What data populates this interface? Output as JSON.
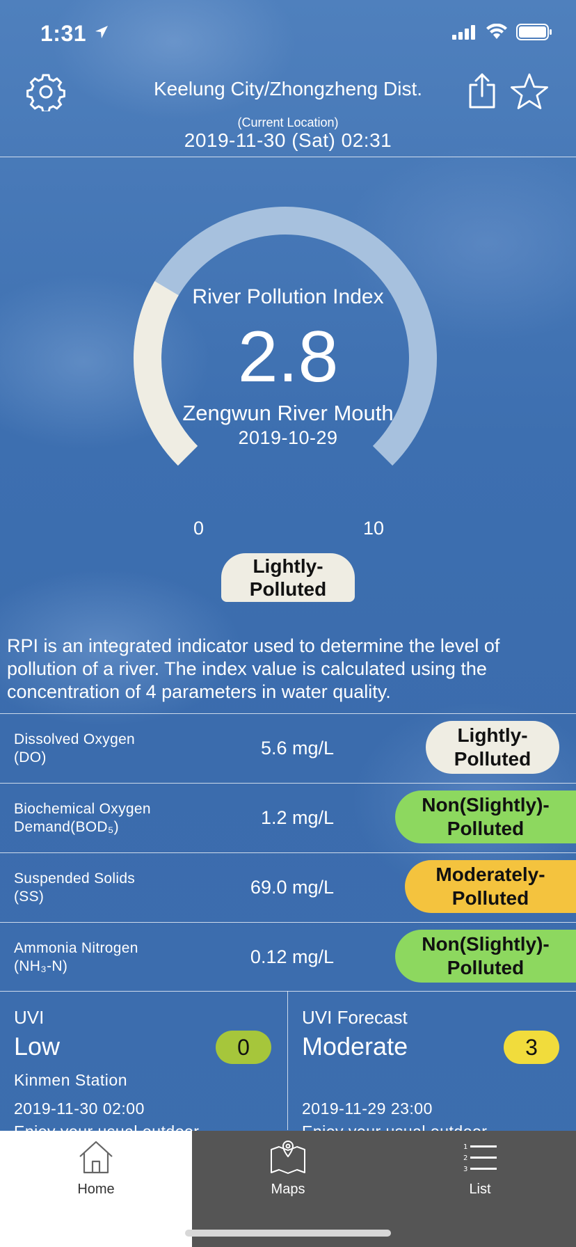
{
  "status_bar": {
    "time": "1:31"
  },
  "header": {
    "location": "Keelung City/Zhongzheng Dist.",
    "current_location_note": "(Current Location)",
    "datetime": "2019-11-30 (Sat) 02:31"
  },
  "gauge": {
    "title": "River Pollution Index",
    "value": "2.8",
    "value_num": 2.8,
    "min": "0",
    "max": "10",
    "min_num": 0,
    "max_num": 10,
    "station": "Zengwun River Mouth",
    "date": "2019-10-29",
    "level_line1": "Lightly-",
    "level_line2": "Polluted"
  },
  "description": "RPI is an integrated indicator used to determine the level of pollution of a river. The index value is calculated using the concentration of 4 parameters in water quality.",
  "parameters": [
    {
      "name_line1": "Dissolved Oxygen",
      "name_line2": "(DO)",
      "value": "5.6 mg/L",
      "status_line1": "Lightly-",
      "status_line2": "Polluted",
      "color": "#efede3"
    },
    {
      "name_line1": "Biochemical Oxygen",
      "name_line2": "Demand(BOD₅)",
      "value": "1.2 mg/L",
      "status_line1": "Non(Slightly)-",
      "status_line2": "Polluted",
      "color": "#8dd85f"
    },
    {
      "name_line1": "Suspended Solids",
      "name_line2": "(SS)",
      "value": "69.0 mg/L",
      "status_line1": "Moderately-",
      "status_line2": "Polluted",
      "color": "#f4c33e"
    },
    {
      "name_line1": "Ammonia Nitrogen",
      "name_line2": "(NH₃-N)",
      "value": "0.12 mg/L",
      "status_line1": "Non(Slightly)-",
      "status_line2": "Polluted",
      "color": "#8dd85f"
    }
  ],
  "uvi": {
    "label": "UVI",
    "level": "Low",
    "value": "0",
    "station": "Kinmen Station",
    "time": "2019-11-30 02:00",
    "advice": "Enjoy your usual outdoor",
    "badge_color": "#a6c63b"
  },
  "uvi_forecast": {
    "label": "UVI Forecast",
    "level": "Moderate",
    "value": "3",
    "time": "2019-11-29 23:00",
    "advice": "Enjoy your usual outdoor",
    "badge_color": "#f1dc3c"
  },
  "tabs": [
    {
      "label": "Home",
      "icon": "home-icon",
      "selected": true
    },
    {
      "label": "Maps",
      "icon": "map-icon",
      "selected": false
    },
    {
      "label": "List",
      "icon": "list-icon",
      "selected": false
    }
  ],
  "colors": {
    "gauge_fill": "#efede3",
    "gauge_track": "#a7c1de",
    "tab_selected_bg": "#ffffff",
    "tab_bar_bg": "#555555"
  }
}
